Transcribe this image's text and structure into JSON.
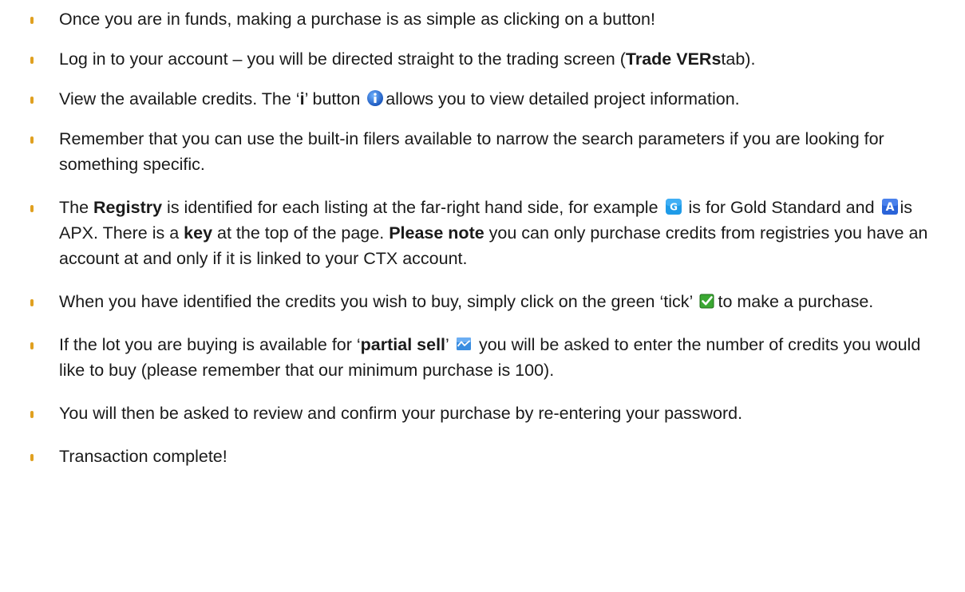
{
  "bullets": {
    "b1": {
      "text": "Once you are in funds, making a purchase is as simple as clicking on a button!"
    },
    "b2": {
      "t1": "Log in to your account – you will be directed straight to the trading screen (",
      "bold1": "Trade VERs",
      "t2": "tab)."
    },
    "b3": {
      "t1": "View the available credits. The ‘",
      "bold1": "i",
      "t2": "’ button ",
      "t3": "allows you to view detailed project information."
    },
    "b4": {
      "text": "Remember that you can use the built-in filers available to narrow the search parameters if you are looking for something specific."
    },
    "b5": {
      "t1": "The ",
      "bold1": "Registry",
      "t2": " is identified for each listing at the far-right hand side, for example ",
      "t3": " is for Gold Standard and ",
      "t4": "is APX. There is a ",
      "bold2": "key",
      "t5": " at the top of the page. ",
      "bold3": "Please note",
      "t6": " you can only purchase credits from registries you have an account at and only if it is linked to your CTX account."
    },
    "b6": {
      "t1": "When you have identified the credits you wish to buy, simply click on the green ‘tick’ ",
      "t2": "to make a purchase."
    },
    "b7": {
      "t1": "If the lot you are buying is available for ‘",
      "bold1": "partial sell",
      "t2": "’ ",
      "t3": " you will be asked to enter the number of credits you would like to buy (please remember that our minimum purchase is 100)."
    },
    "b8": {
      "text": "You will then be asked to review and confirm your purchase by re-entering your password."
    },
    "b9": {
      "text": "Transaction complete!"
    }
  },
  "icons": {
    "info": {
      "name": "info-icon",
      "letter": "i",
      "color": "#1d6fd6"
    },
    "gold_standard": {
      "name": "gold-standard-icon",
      "letter": "G",
      "color": "#1e9be8"
    },
    "apx": {
      "name": "apx-icon",
      "letter": "A",
      "color": "#2a63d8"
    },
    "tick": {
      "name": "green-tick-icon",
      "color": "#3aa832"
    },
    "partial_sell": {
      "name": "partial-sell-icon",
      "color": "#3a8de0"
    }
  },
  "colors": {
    "bullet": "#e0a020",
    "text": "#1a1a1a"
  }
}
